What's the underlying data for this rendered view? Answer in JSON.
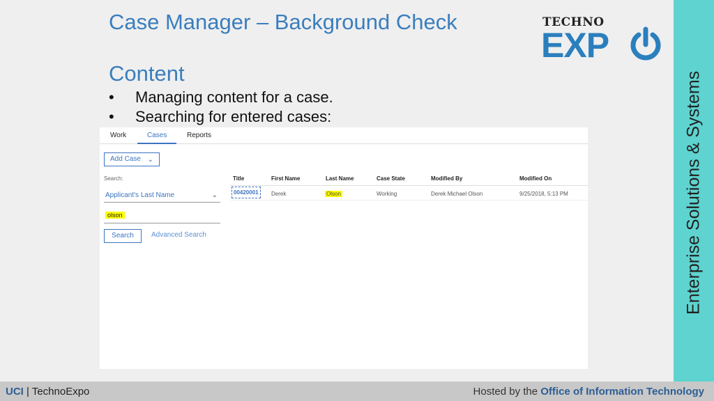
{
  "slide": {
    "title": "Case Manager – Background Check",
    "section_heading": "Content",
    "bullets": [
      "Managing content for a case.",
      "Searching for entered cases:"
    ],
    "bullet_glyph": "•"
  },
  "logo": {
    "line1": "TECHNO",
    "line2": "EXP"
  },
  "side_band": {
    "text": "Enterprise Solutions & Systems",
    "color": "#5ed3cf"
  },
  "app": {
    "tabs": [
      "Work",
      "Cases",
      "Reports"
    ],
    "active_tab": "Cases",
    "add_case_label": "Add Case",
    "search_label": "Search:",
    "search_field_selected": "Applicant's Last Name",
    "search_query": "olson",
    "search_button": "Search",
    "advanced_search_link": "Advanced Search",
    "results": {
      "columns": [
        "Title",
        "First Name",
        "Last Name",
        "Case State",
        "Modified By",
        "Modified On"
      ],
      "rows": [
        [
          "00420001",
          "Derek",
          "Olson",
          "Working",
          "Derek Michael Olson",
          "9/25/2018, 5:13 PM"
        ]
      ]
    }
  },
  "footer": {
    "left_bold": "UCI",
    "left_sep": "|",
    "left_text": "TechnoExpo",
    "right_text": "Hosted by the",
    "right_bold": "Office of Information Technology"
  },
  "colors": {
    "title_blue": "#3a7ebd",
    "accent": "#3b74c0",
    "highlight": "#ffff00"
  }
}
